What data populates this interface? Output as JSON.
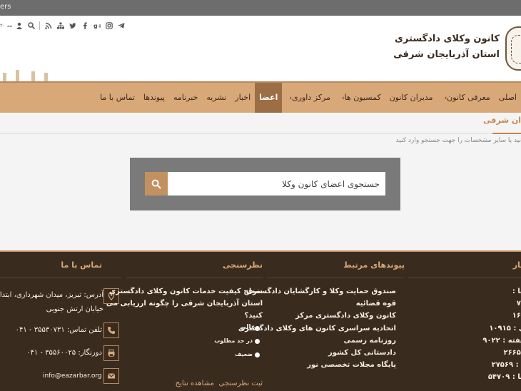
{
  "topbar": {
    "text": "ers"
  },
  "header": {
    "date": "۲۰ مه",
    "title_line1": "کانون وکلای دادگستری",
    "title_line2": "استان آذربایجان شرقی"
  },
  "nav": {
    "items": [
      {
        "label": "اصلی"
      },
      {
        "label": "معرفی کانون",
        "caret": "›"
      },
      {
        "label": "مدیران کانون"
      },
      {
        "label": "کمسیون ها",
        "caret": "›"
      },
      {
        "label": "مرکز داوری",
        "caret": "›"
      },
      {
        "label": "اعضا",
        "active": true
      },
      {
        "label": "اخبار"
      },
      {
        "label": "نشریه"
      },
      {
        "label": "خبرنامه"
      },
      {
        "label": "پیوندها"
      },
      {
        "label": "تماس با ما"
      }
    ]
  },
  "breadcrumb": "ان شرقی",
  "hint": "نید یا سایر مشخصات را جهت جستجو وارد کنید",
  "search": {
    "placeholder": "جستجوی اعضای کانون وکلا"
  },
  "footer": {
    "contact": {
      "title": "تماس با ما",
      "address_line1": "آدرس: تبریز، میدان شهرداری، ابتدا",
      "address_line2": "خیابان ارتش جنوبی",
      "phone": "تلفن تماس: ۳۵۵۳۰۷۳۱ - ۰۴۱",
      "fax": "دورنگار: ۳۵۵۶۰۰۲۵ - ۰۴۱",
      "email": "info@eazarbar.org"
    },
    "poll": {
      "title": "نظرسنجی",
      "question_line1": "سطح کیفیت خدمات کانون وکلای دادگستری",
      "question_line2": "استان آذربایجان شرقی را چگونه ارزیابی می",
      "question_line3": "کنید؟",
      "options": [
        "عالی",
        "در حد مطلوب",
        "ضعیف"
      ],
      "submit": "ثبت نظرسنجی",
      "results": "مشاهده نتایج"
    },
    "links": {
      "title": "پیوندهای مرتبط",
      "items": [
        "صندوق حمایت وکلا و کارگشایان دادگستری",
        "قوه قضائیه",
        "کانون وکلای دادگستری مرکز",
        "اتحادیه سراسری کانون های وکلای دادگستری",
        "روزنامه رسمی",
        "دادستانی کل کشور",
        "پایگاه مجلات تخصصی نور"
      ]
    },
    "stats": {
      "title": "مار",
      "rows": [
        "ها :",
        "۷۳",
        "۱۶۳",
        "ی : ۱۰۹۱۵",
        "هفته : ۹۰۲۲",
        "۲۶۶۵۲",
        "ه : ۲۷۵۶۹",
        "ها : ۵۴۷۰۹"
      ]
    }
  }
}
